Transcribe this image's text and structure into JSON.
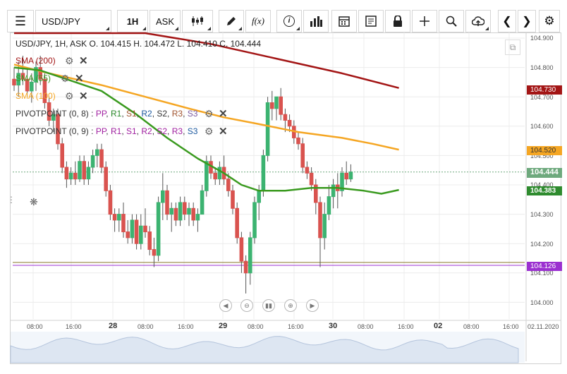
{
  "toolbar": {
    "symbol": "USD/JPY",
    "timeframe": "1H",
    "price_side": "ASK",
    "function_label": "f(x)"
  },
  "header": {
    "ohlc": "USD/JPY, 1H, ASK   O. 104.415 H. 104.472 L. 104.410 C. 104.444"
  },
  "legend": {
    "sma200": "SMA (200)",
    "sma55": "SMA (55)",
    "sma100": "SMA (100)",
    "pivot1_name": "PIVOTPOINT (0, 8)",
    "pivot2_name": "PIVOTPOINT (0, 9)",
    "pivot_items": [
      "PP",
      "R1",
      "S1",
      "R2",
      "S2",
      "R3",
      "S3"
    ]
  },
  "colors": {
    "sma200": "#a31515",
    "sma55": "#3a9a1f",
    "sma100": "#f5a623",
    "up_candle": "#3cb371",
    "down_candle": "#d9534f",
    "current_price": "#6ea97d",
    "pivot_line": "#9b30d0",
    "pivot_olive": "#8a7a2a"
  },
  "price_tags": {
    "sma200": "104.730",
    "sma100": "104.520",
    "current": "104.444",
    "sma55": "104.383",
    "pivot": "104.126"
  },
  "chart_data": {
    "type": "candlestick",
    "ylim": [
      103.94,
      104.93
    ],
    "y_ticks": [
      "104.900",
      "104.800",
      "104.700",
      "104.600",
      "104.500",
      "104.400",
      "104.300",
      "104.200",
      "104.100",
      "104.000"
    ],
    "x_ticks": [
      "08:00",
      "16:00",
      "28",
      "08:00",
      "16:00",
      "29",
      "08:00",
      "16:00",
      "30",
      "08:00",
      "16:00",
      "02",
      "08:00",
      "16:00",
      "02.11.2020"
    ],
    "candles": [
      {
        "o": 104.76,
        "h": 104.8,
        "l": 104.72,
        "c": 104.74
      },
      {
        "o": 104.74,
        "h": 104.82,
        "l": 104.7,
        "c": 104.78
      },
      {
        "o": 104.78,
        "h": 104.84,
        "l": 104.74,
        "c": 104.76
      },
      {
        "o": 104.76,
        "h": 104.8,
        "l": 104.7,
        "c": 104.72
      },
      {
        "o": 104.72,
        "h": 104.78,
        "l": 104.68,
        "c": 104.75
      },
      {
        "o": 104.75,
        "h": 104.82,
        "l": 104.72,
        "c": 104.8
      },
      {
        "o": 104.8,
        "h": 104.84,
        "l": 104.74,
        "c": 104.76
      },
      {
        "o": 104.76,
        "h": 104.78,
        "l": 104.66,
        "c": 104.68
      },
      {
        "o": 104.68,
        "h": 104.7,
        "l": 104.6,
        "c": 104.62
      },
      {
        "o": 104.62,
        "h": 104.66,
        "l": 104.58,
        "c": 104.64
      },
      {
        "o": 104.64,
        "h": 104.66,
        "l": 104.52,
        "c": 104.54
      },
      {
        "o": 104.54,
        "h": 104.56,
        "l": 104.44,
        "c": 104.46
      },
      {
        "o": 104.46,
        "h": 104.48,
        "l": 104.39,
        "c": 104.42
      },
      {
        "o": 104.42,
        "h": 104.46,
        "l": 104.4,
        "c": 104.44
      },
      {
        "o": 104.44,
        "h": 104.48,
        "l": 104.4,
        "c": 104.42
      },
      {
        "o": 104.42,
        "h": 104.5,
        "l": 104.41,
        "c": 104.48
      },
      {
        "o": 104.48,
        "h": 104.5,
        "l": 104.4,
        "c": 104.42
      },
      {
        "o": 104.42,
        "h": 104.48,
        "l": 104.4,
        "c": 104.46
      },
      {
        "o": 104.46,
        "h": 104.52,
        "l": 104.44,
        "c": 104.5
      },
      {
        "o": 104.5,
        "h": 104.54,
        "l": 104.46,
        "c": 104.52
      },
      {
        "o": 104.52,
        "h": 104.54,
        "l": 104.44,
        "c": 104.46
      },
      {
        "o": 104.46,
        "h": 104.48,
        "l": 104.36,
        "c": 104.38
      },
      {
        "o": 104.38,
        "h": 104.4,
        "l": 104.28,
        "c": 104.3
      },
      {
        "o": 104.3,
        "h": 104.32,
        "l": 104.24,
        "c": 104.28
      },
      {
        "o": 104.28,
        "h": 104.32,
        "l": 104.24,
        "c": 104.3
      },
      {
        "o": 104.3,
        "h": 104.34,
        "l": 104.22,
        "c": 104.24
      },
      {
        "o": 104.24,
        "h": 104.28,
        "l": 104.2,
        "c": 104.22
      },
      {
        "o": 104.22,
        "h": 104.3,
        "l": 104.2,
        "c": 104.28
      },
      {
        "o": 104.28,
        "h": 104.3,
        "l": 104.18,
        "c": 104.2
      },
      {
        "o": 104.2,
        "h": 104.3,
        "l": 104.18,
        "c": 104.26
      },
      {
        "o": 104.26,
        "h": 104.32,
        "l": 104.22,
        "c": 104.24
      },
      {
        "o": 104.24,
        "h": 104.26,
        "l": 104.16,
        "c": 104.18
      },
      {
        "o": 104.18,
        "h": 104.22,
        "l": 104.12,
        "c": 104.16
      },
      {
        "o": 104.16,
        "h": 104.36,
        "l": 104.14,
        "c": 104.34
      },
      {
        "o": 104.34,
        "h": 104.44,
        "l": 104.28,
        "c": 104.38
      },
      {
        "o": 104.38,
        "h": 104.4,
        "l": 104.28,
        "c": 104.3
      },
      {
        "o": 104.3,
        "h": 104.34,
        "l": 104.24,
        "c": 104.32
      },
      {
        "o": 104.32,
        "h": 104.34,
        "l": 104.26,
        "c": 104.28
      },
      {
        "o": 104.28,
        "h": 104.36,
        "l": 104.26,
        "c": 104.34
      },
      {
        "o": 104.34,
        "h": 104.36,
        "l": 104.28,
        "c": 104.3
      },
      {
        "o": 104.3,
        "h": 104.34,
        "l": 104.26,
        "c": 104.32
      },
      {
        "o": 104.32,
        "h": 104.34,
        "l": 104.26,
        "c": 104.28
      },
      {
        "o": 104.28,
        "h": 104.32,
        "l": 104.24,
        "c": 104.3
      },
      {
        "o": 104.3,
        "h": 104.4,
        "l": 104.3,
        "c": 104.38
      },
      {
        "o": 104.38,
        "h": 104.5,
        "l": 104.36,
        "c": 104.48
      },
      {
        "o": 104.48,
        "h": 104.5,
        "l": 104.42,
        "c": 104.44
      },
      {
        "o": 104.44,
        "h": 104.46,
        "l": 104.4,
        "c": 104.42
      },
      {
        "o": 104.42,
        "h": 104.48,
        "l": 104.4,
        "c": 104.46
      },
      {
        "o": 104.46,
        "h": 104.5,
        "l": 104.4,
        "c": 104.42
      },
      {
        "o": 104.42,
        "h": 104.44,
        "l": 104.36,
        "c": 104.38
      },
      {
        "o": 104.38,
        "h": 104.4,
        "l": 104.3,
        "c": 104.32
      },
      {
        "o": 104.32,
        "h": 104.34,
        "l": 104.2,
        "c": 104.22
      },
      {
        "o": 104.22,
        "h": 104.24,
        "l": 104.1,
        "c": 104.14
      },
      {
        "o": 104.14,
        "h": 104.16,
        "l": 104.03,
        "c": 104.1
      },
      {
        "o": 104.1,
        "h": 104.24,
        "l": 104.06,
        "c": 104.22
      },
      {
        "o": 104.22,
        "h": 104.36,
        "l": 104.2,
        "c": 104.34
      },
      {
        "o": 104.34,
        "h": 104.4,
        "l": 104.28,
        "c": 104.38
      },
      {
        "o": 104.38,
        "h": 104.52,
        "l": 104.36,
        "c": 104.5
      },
      {
        "o": 104.5,
        "h": 104.7,
        "l": 104.48,
        "c": 104.68
      },
      {
        "o": 104.68,
        "h": 104.72,
        "l": 104.62,
        "c": 104.66
      },
      {
        "o": 104.66,
        "h": 104.7,
        "l": 104.62,
        "c": 104.7
      },
      {
        "o": 104.7,
        "h": 104.73,
        "l": 104.62,
        "c": 104.64
      },
      {
        "o": 104.64,
        "h": 104.66,
        "l": 104.58,
        "c": 104.62
      },
      {
        "o": 104.62,
        "h": 104.64,
        "l": 104.58,
        "c": 104.6
      },
      {
        "o": 104.6,
        "h": 104.62,
        "l": 104.54,
        "c": 104.56
      },
      {
        "o": 104.56,
        "h": 104.58,
        "l": 104.52,
        "c": 104.54
      },
      {
        "o": 104.54,
        "h": 104.56,
        "l": 104.44,
        "c": 104.46
      },
      {
        "o": 104.46,
        "h": 104.48,
        "l": 104.42,
        "c": 104.44
      },
      {
        "o": 104.44,
        "h": 104.46,
        "l": 104.38,
        "c": 104.4
      },
      {
        "o": 104.4,
        "h": 104.42,
        "l": 104.3,
        "c": 104.34
      },
      {
        "o": 104.34,
        "h": 104.36,
        "l": 104.12,
        "c": 104.22
      },
      {
        "o": 104.22,
        "h": 104.34,
        "l": 104.18,
        "c": 104.3
      },
      {
        "o": 104.3,
        "h": 104.4,
        "l": 104.28,
        "c": 104.36
      },
      {
        "o": 104.36,
        "h": 104.42,
        "l": 104.32,
        "c": 104.4
      },
      {
        "o": 104.4,
        "h": 104.44,
        "l": 104.32,
        "c": 104.38
      },
      {
        "o": 104.38,
        "h": 104.46,
        "l": 104.36,
        "c": 104.44
      },
      {
        "o": 104.44,
        "h": 104.48,
        "l": 104.4,
        "c": 104.42
      },
      {
        "o": 104.42,
        "h": 104.47,
        "l": 104.41,
        "c": 104.444
      }
    ],
    "series": [
      {
        "name": "SMA (200)",
        "values": [
          [
            0,
            104.98
          ],
          [
            30,
            104.95
          ],
          [
            45,
            104.88
          ],
          [
            60,
            104.83
          ],
          [
            75,
            104.78
          ],
          [
            88,
            104.73
          ]
        ]
      },
      {
        "name": "SMA (100)",
        "values": [
          [
            0,
            104.81
          ],
          [
            8,
            104.78
          ],
          [
            20,
            104.74
          ],
          [
            30,
            104.7
          ],
          [
            40,
            104.66
          ],
          [
            48,
            104.63
          ],
          [
            55,
            104.61
          ],
          [
            65,
            104.58
          ],
          [
            75,
            104.56
          ],
          [
            82,
            104.54
          ],
          [
            88,
            104.52
          ]
        ]
      },
      {
        "name": "SMA (55)",
        "values": [
          [
            0,
            104.8
          ],
          [
            6,
            104.79
          ],
          [
            12,
            104.76
          ],
          [
            20,
            104.72
          ],
          [
            28,
            104.64
          ],
          [
            35,
            104.56
          ],
          [
            42,
            104.49
          ],
          [
            48,
            104.44
          ],
          [
            52,
            104.4
          ],
          [
            56,
            104.38
          ],
          [
            62,
            104.38
          ],
          [
            68,
            104.39
          ],
          [
            74,
            104.39
          ],
          [
            80,
            104.38
          ],
          [
            84,
            104.37
          ],
          [
            88,
            104.383
          ]
        ]
      }
    ],
    "horizontal_lines": [
      {
        "value": 104.444
      },
      {
        "value": 104.136
      },
      {
        "value": 104.126
      }
    ]
  }
}
